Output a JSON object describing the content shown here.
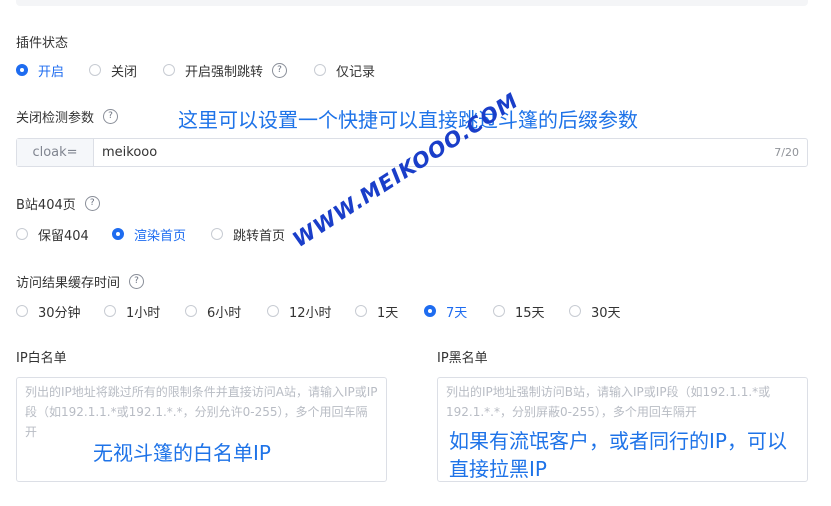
{
  "plugin_status": {
    "label": "插件状态",
    "options": [
      {
        "label": "开启",
        "checked": true
      },
      {
        "label": "关闭",
        "checked": false
      },
      {
        "label": "开启强制跳转",
        "checked": false
      },
      {
        "label": "仅记录",
        "checked": false
      }
    ]
  },
  "close_param": {
    "label": "关闭检测参数",
    "prefix": "cloak=",
    "value": "meikooo",
    "counter": "7/20",
    "annotation": "这里可以设置一个快捷可以直接跳过斗篷的后缀参数"
  },
  "b404": {
    "label": "B站404页",
    "options": [
      {
        "label": "保留404",
        "checked": false
      },
      {
        "label": "渲染首页",
        "checked": true
      },
      {
        "label": "跳转首页",
        "checked": false
      }
    ]
  },
  "cache": {
    "label": "访问结果缓存时间",
    "options": [
      {
        "label": "30分钟",
        "checked": false
      },
      {
        "label": "1小时",
        "checked": false
      },
      {
        "label": "6小时",
        "checked": false
      },
      {
        "label": "12小时",
        "checked": false
      },
      {
        "label": "1天",
        "checked": false
      },
      {
        "label": "7天",
        "checked": true
      },
      {
        "label": "15天",
        "checked": false
      },
      {
        "label": "30天",
        "checked": false
      }
    ]
  },
  "whitelist": {
    "label": "IP白名单",
    "placeholder": "列出的IP地址将跳过所有的限制条件并直接访问A站，请输入IP或IP段（如192.1.1.*或192.1.*.*，分别允许0-255），多个用回车隔开",
    "annotation": "无视斗篷的白名单IP"
  },
  "blacklist": {
    "label": "IP黑名单",
    "placeholder": "列出的IP地址强制访问B站，请输入IP或IP段（如192.1.1.*或192.1.*.*，分别屏蔽0-255），多个用回车隔开",
    "annotation_line1": "如果有流氓客户，或者同行的IP，可以",
    "annotation_line2": "直接拉黑IP"
  },
  "watermark": "WWW.MEIKOOO.COM",
  "colors": {
    "accent": "#1e6cf0",
    "annotation": "#1e73e8",
    "watermark": "#1a3ec9"
  }
}
